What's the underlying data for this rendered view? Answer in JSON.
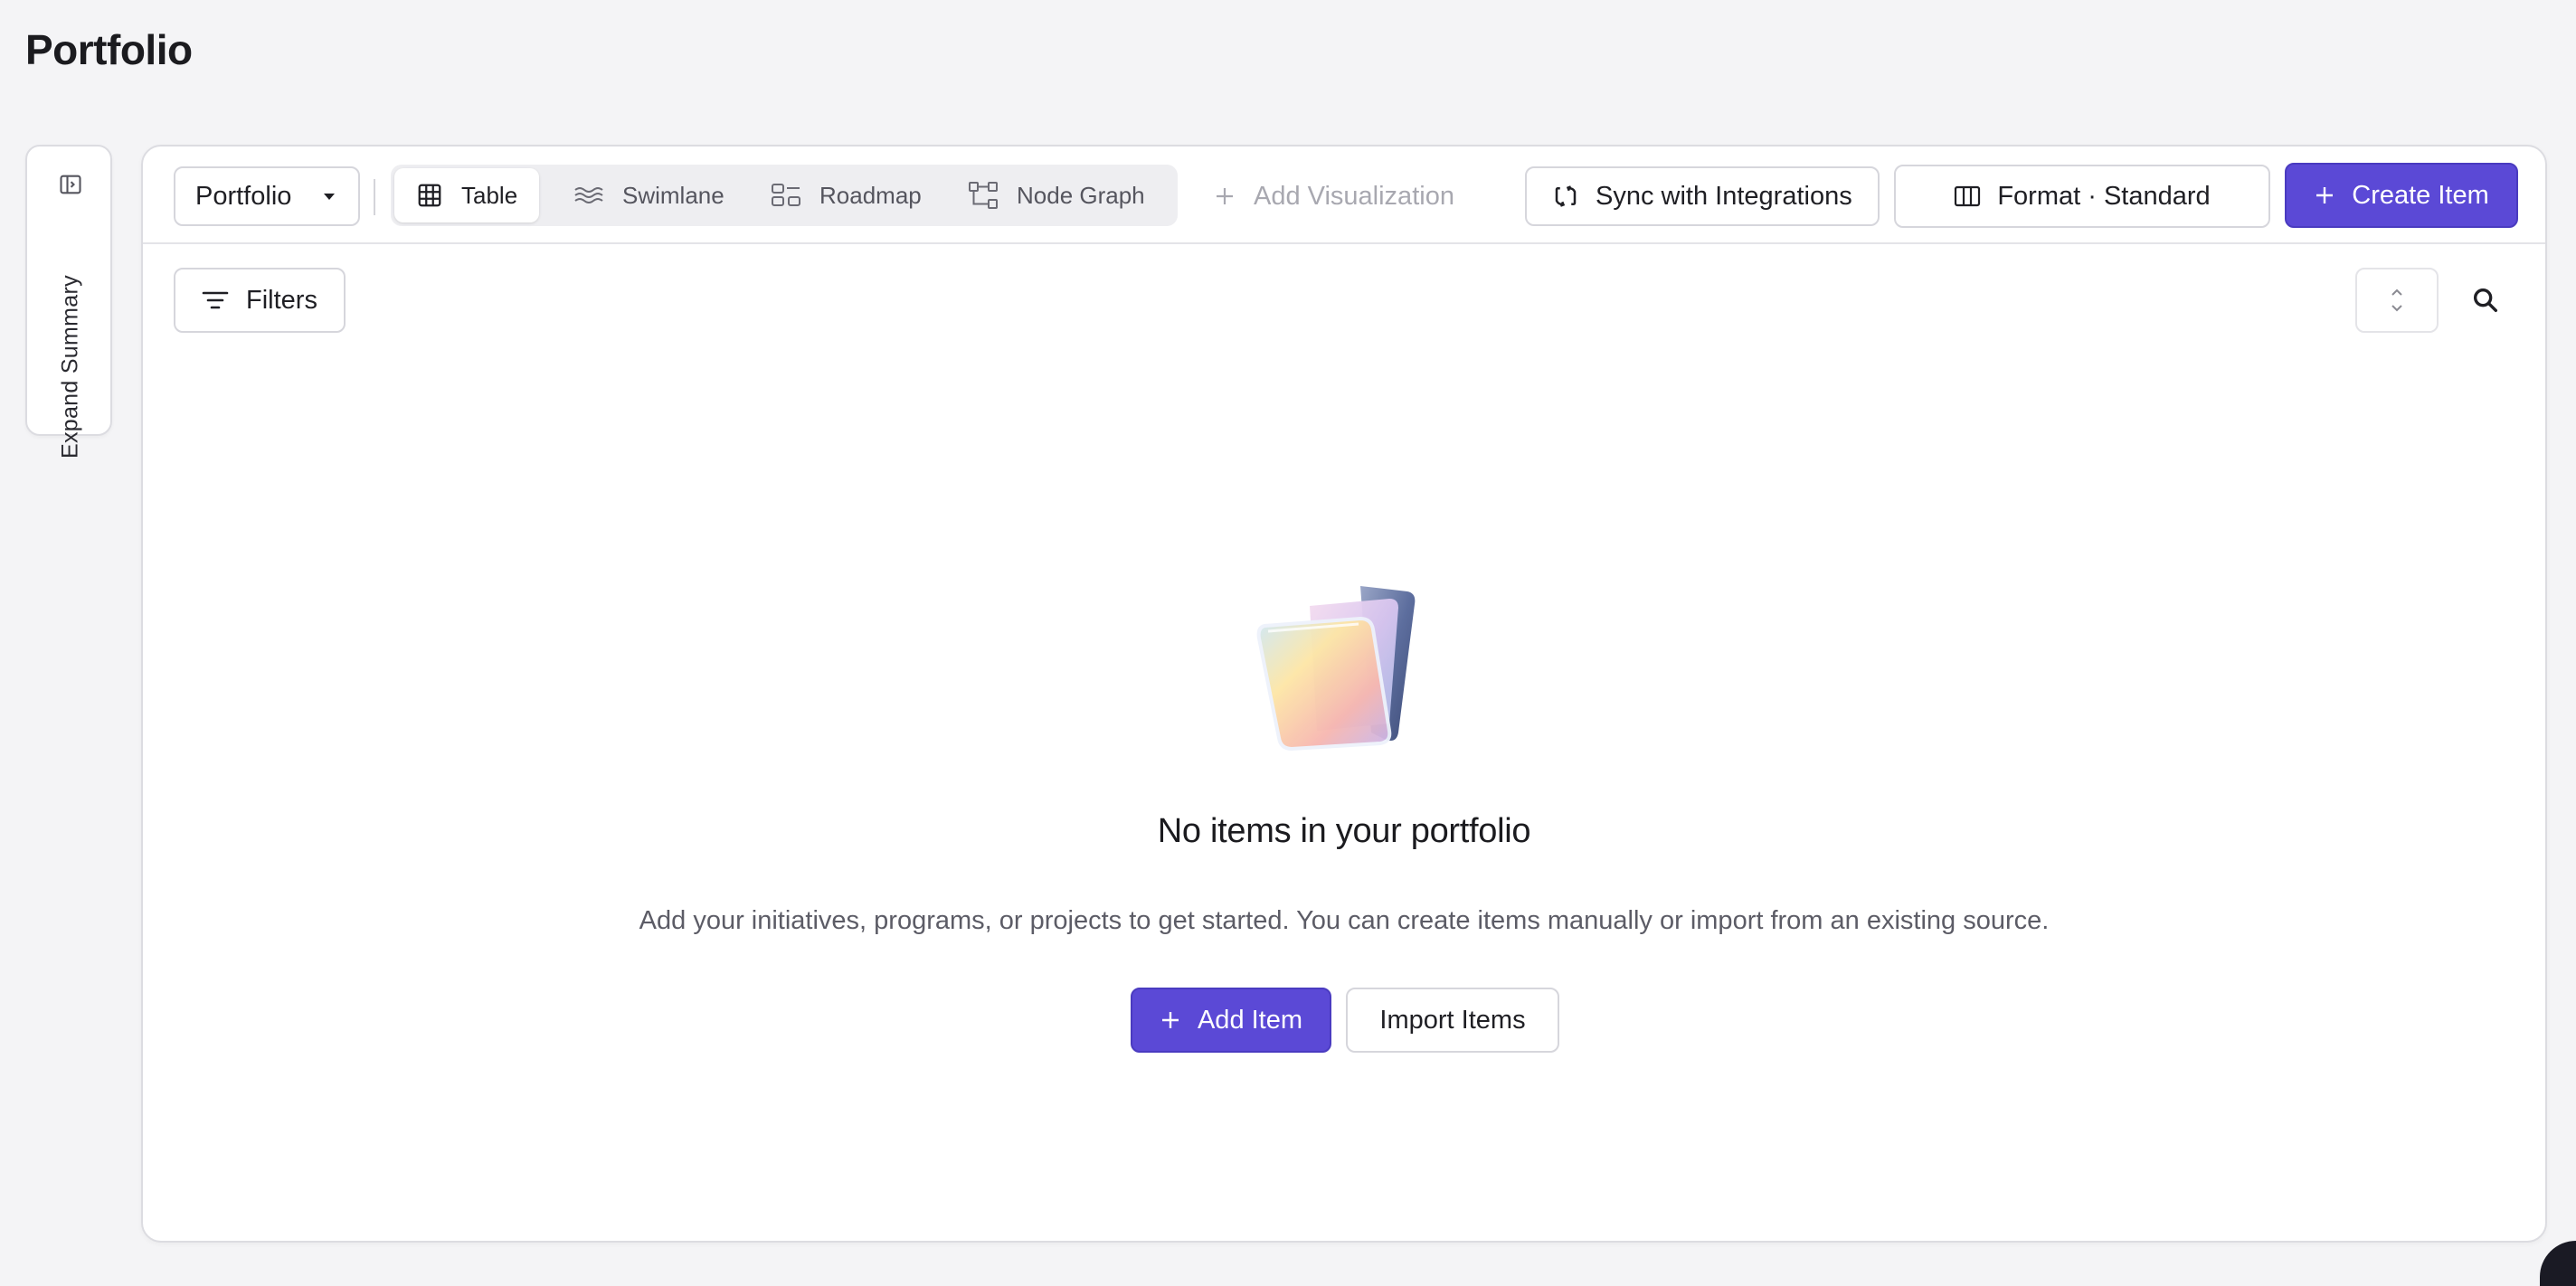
{
  "page": {
    "title": "Portfolio"
  },
  "summary": {
    "expand_label": "Expand Summary"
  },
  "toolbar": {
    "portfolio_select": "Portfolio",
    "views": [
      {
        "label": "Table",
        "icon": "table-icon",
        "active": true
      },
      {
        "label": "Swimlane",
        "icon": "swimlane-icon",
        "active": false
      },
      {
        "label": "Roadmap",
        "icon": "roadmap-icon",
        "active": false
      },
      {
        "label": "Node Graph",
        "icon": "node-graph-icon",
        "active": false
      }
    ],
    "add_visualization": "Add Visualization",
    "sync_label": "Sync with Integrations",
    "format_label": "Format · Standard",
    "create_label": "Create Item"
  },
  "filters": {
    "label": "Filters"
  },
  "empty_state": {
    "title": "No items in your portfolio",
    "description": "Add your initiatives, programs, or projects to get started. You can create items manually or import from an existing source.",
    "primary_label": "Add Item",
    "secondary_label": "Import Items"
  },
  "colors": {
    "accent": "#5b49d6",
    "background": "#f4f4f6",
    "border": "#dcdce1"
  }
}
